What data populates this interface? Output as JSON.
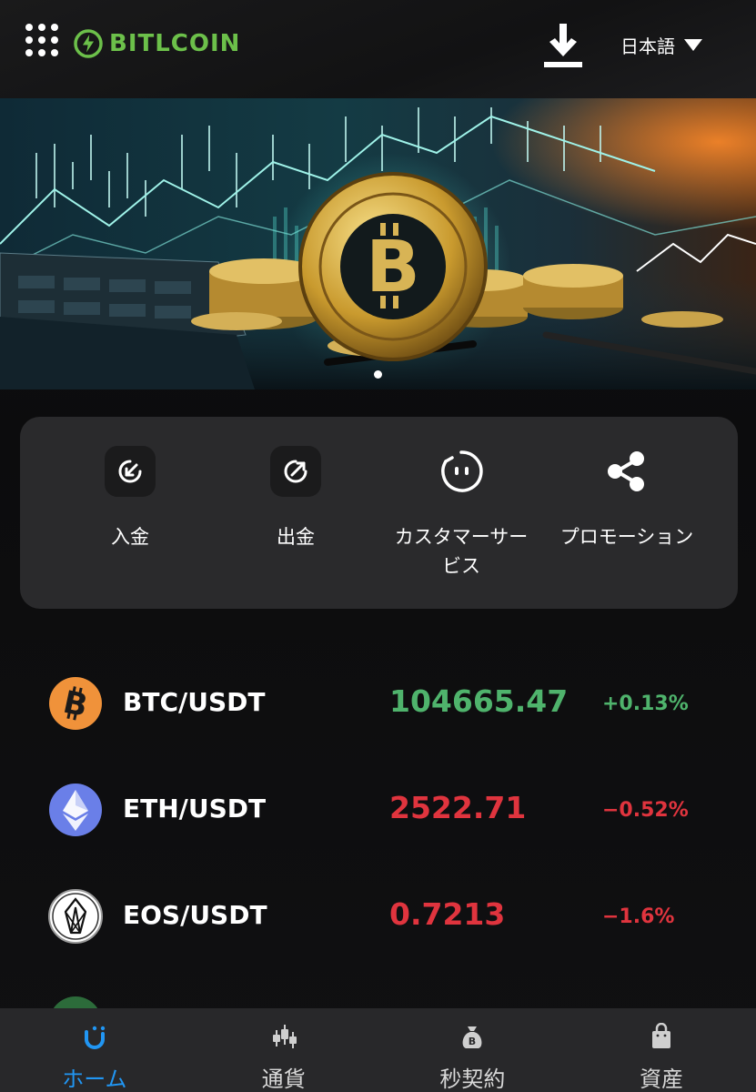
{
  "header": {
    "logo_text": "BITLCOIN",
    "language": "日本語",
    "icons": [
      "grid-menu-icon",
      "download-icon",
      "caret-down-icon"
    ]
  },
  "banner": {
    "slide_count": 1,
    "active_slide": 1
  },
  "quick_actions": [
    {
      "label": "入金",
      "icon": "deposit-arrow-icon"
    },
    {
      "label": "出金",
      "icon": "withdraw-arrow-icon"
    },
    {
      "label": "カスタマーサービス",
      "label_line1": "カスタマーサー",
      "label_line2": "ビス",
      "icon": "chat-face-icon"
    },
    {
      "label": "プロモーション",
      "icon": "share-icon"
    }
  ],
  "market": [
    {
      "pair": "BTC/USDT",
      "price": "104665.47",
      "change": "+0.13%",
      "trend": "up",
      "icon": "btc-icon"
    },
    {
      "pair": "ETH/USDT",
      "price": "2522.71",
      "change": "−0.52%",
      "trend": "down",
      "icon": "eth-icon"
    },
    {
      "pair": "EOS/USDT",
      "price": "0.7213",
      "change": "−1.6%",
      "trend": "down",
      "icon": "eos-icon"
    }
  ],
  "nav": [
    {
      "label": "ホーム",
      "icon": "home-icon",
      "active": true
    },
    {
      "label": "通貨",
      "icon": "candlestick-icon",
      "active": false
    },
    {
      "label": "秒契約",
      "icon": "bitcoin-bag-icon",
      "active": false
    },
    {
      "label": "資産",
      "icon": "wallet-bag-icon",
      "active": false
    }
  ],
  "colors": {
    "brand_green": "#6cc04a",
    "up": "#4fb36c",
    "down": "#e0343e",
    "active_nav": "#2196f3",
    "card_bg": "#2a2a2c",
    "nav_bg": "#28282a"
  }
}
